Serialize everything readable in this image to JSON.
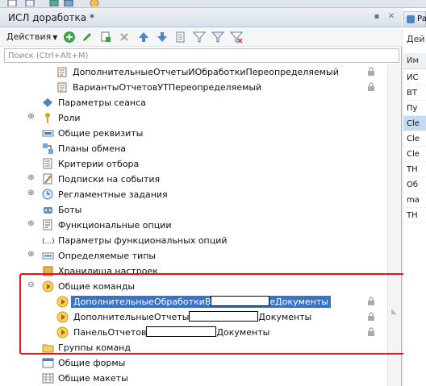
{
  "window": {
    "title": "ИСЛ доработка *"
  },
  "toolbar": {
    "actions_label": "Действия"
  },
  "search": {
    "placeholder": "Поиск (Ctrl+Alt+M)"
  },
  "tree": [
    {
      "label": "ДополнительныеОтчетыИОбработкиПереопределяемый",
      "icon": "common-module-icon",
      "locked": true
    },
    {
      "label": "ВариантыОтчетовУТПереопределяемый",
      "icon": "common-module-icon",
      "locked": true
    },
    {
      "label": "Параметры сеанса",
      "icon": "session-params-icon",
      "expander": false
    },
    {
      "label": "Роли",
      "icon": "role-key-icon",
      "expander": true
    },
    {
      "label": "Общие реквизиты",
      "icon": "common-attribute-icon",
      "expander": false
    },
    {
      "label": "Планы обмена",
      "icon": "exchange-plan-icon",
      "expander": false
    },
    {
      "label": "Критерии отбора",
      "icon": "filter-criteria-icon",
      "expander": false
    },
    {
      "label": "Подписки на события",
      "icon": "event-subscription-icon",
      "expander": true
    },
    {
      "label": "Регламентные задания",
      "icon": "scheduled-job-icon",
      "expander": true
    },
    {
      "label": "Боты",
      "icon": "bot-icon",
      "expander": false
    },
    {
      "label": "Функциональные опции",
      "icon": "functional-option-icon",
      "expander": true
    },
    {
      "label": "Параметры функциональных опций",
      "icon": "functional-params-icon",
      "expander": false
    },
    {
      "label": "Определяемые типы",
      "icon": "defined-type-icon",
      "expander": true
    },
    {
      "label": "Хранилища настроек",
      "icon": "settings-storage-icon",
      "expander": false
    },
    {
      "label": "Общие команды",
      "icon": "common-command-icon",
      "expander": true,
      "expanded": true
    },
    {
      "label_before": "ДополнительныеОбработкиВ",
      "label_after": "еДокументы",
      "icon": "command-icon",
      "locked": true,
      "selected": true
    },
    {
      "label_before": "ДополнительныеОтчеты",
      "label_after": "Документы",
      "icon": "command-icon",
      "locked": true
    },
    {
      "label_before": "ПанельОтчетов",
      "label_after": "Документы",
      "icon": "command-icon",
      "locked": true
    },
    {
      "label": "Группы команд",
      "icon": "folder-icon",
      "expander": false
    },
    {
      "label": "Общие формы",
      "icon": "common-form-icon",
      "expander": false
    },
    {
      "label": "Общие макеты",
      "icon": "common-template-icon",
      "expander": false
    }
  ],
  "side_panel": {
    "tab_label": "Ра",
    "label": "Дей",
    "column_header": "Им",
    "items": [
      "ИС",
      "ВТ",
      "Пу",
      "Cle",
      "Cle",
      "Cle",
      "ТН",
      "Об",
      "ma",
      "ТН"
    ]
  }
}
